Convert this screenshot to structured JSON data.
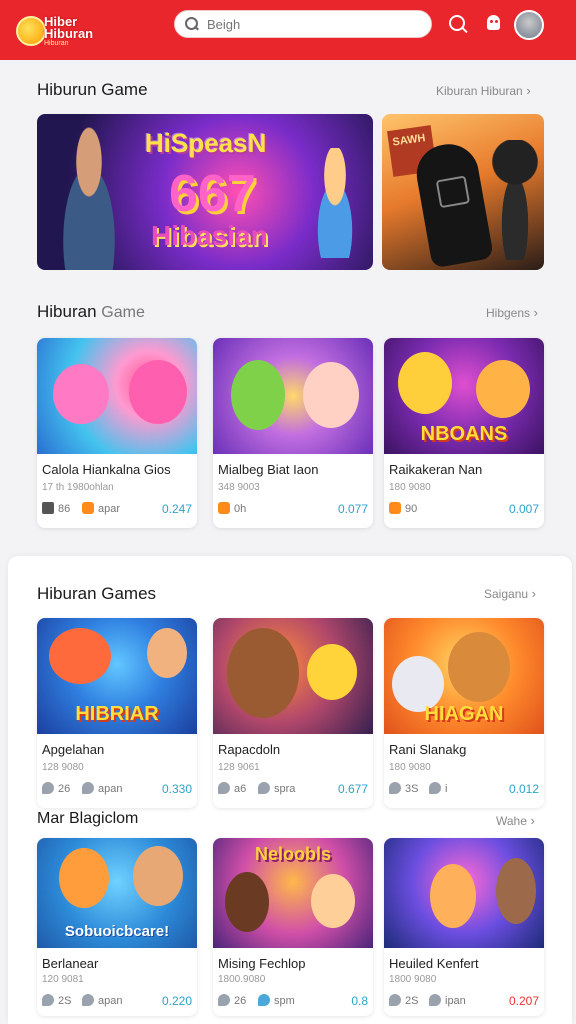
{
  "header": {
    "logo_text": "Hiber Hiburan",
    "logo_sub": "Hiburan",
    "search_placeholder": "Beigh",
    "brand_color": "#e8262c"
  },
  "section1": {
    "title": "Hiburun Game",
    "see_all": "Kiburan Hiburan",
    "banner1": {
      "title": "HiSpeasN",
      "number": "667",
      "sub": "Hibasian"
    },
    "banner2": {
      "sign": "SAWH"
    }
  },
  "section2": {
    "title": "Hiburan",
    "title_light": "Game",
    "see_all": "Hibgens",
    "cards": [
      {
        "title": "Calola Hiankalna Gios",
        "sub": "17 th 1980ohlan",
        "a": "86",
        "b": "apar",
        "r": "0.247",
        "thumb_text": ""
      },
      {
        "title": "Mialbeg Biat Iaon",
        "sub": "348 9003",
        "a": "0h",
        "b": "",
        "r": "0.077",
        "thumb_text": ""
      },
      {
        "title": "Raikakeran Nan",
        "sub": "180 9080",
        "a": "90",
        "b": "",
        "r": "0.007",
        "thumb_text": "NBOANS"
      }
    ]
  },
  "section3": {
    "title": "Hiburan Games",
    "see_all": "Saiganu",
    "cards": [
      {
        "title": "Apgelahan",
        "sub": "128 9080",
        "a": "26",
        "b": "apan",
        "r": "0.330",
        "thumb_text": "HIBRIAR"
      },
      {
        "title": "Rapacdoln",
        "sub": "128 9061",
        "a": "a6",
        "b": "spra",
        "r": "0.677",
        "thumb_text": ""
      },
      {
        "title": "Rani Slanakg",
        "sub": "180 9080",
        "a": "3S",
        "b": "i",
        "r": "0.012",
        "thumb_text": "HIAGAN"
      }
    ]
  },
  "section4": {
    "title": "Mar Blagiclom",
    "see_all": "Wahe",
    "cards": [
      {
        "title": "Berlanear",
        "sub": "120 9081",
        "a": "2S",
        "b": "apan",
        "r": "0.220",
        "thumb_text": "Sobuoicbcare!"
      },
      {
        "title": "Mising Fechlop",
        "sub": "1800.9080",
        "a": "26",
        "b": "spm",
        "r": "0.8",
        "thumb_text": "Neloobls"
      },
      {
        "title": "Heuiled Kenfert",
        "sub": "1800 9080",
        "a": "2S",
        "b": "ipan",
        "r": "0.207",
        "thumb_text": ""
      }
    ]
  }
}
